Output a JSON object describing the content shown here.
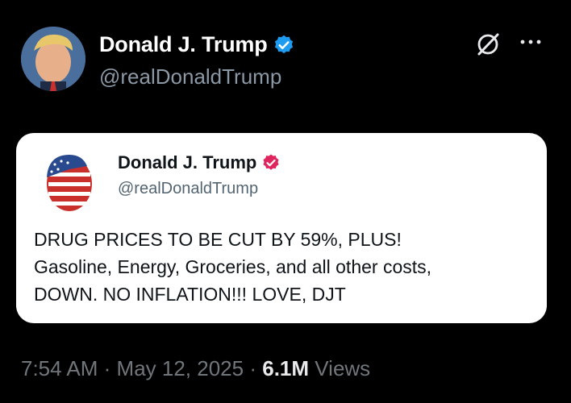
{
  "header": {
    "name": "Donald J. Trump",
    "handle": "@realDonaldTrump",
    "avatar_icon": "portrait-avatar",
    "verified_icon": "verified-badge-icon",
    "grok_icon": "grok-icon",
    "more_icon": "more-options-icon",
    "verified_color": "#1d9bf0"
  },
  "quoted_post": {
    "name": "Donald J. Trump",
    "handle": "@realDonaldTrump",
    "avatar_icon": "flag-portrait-avatar",
    "verified_icon": "verified-badge-icon",
    "verified_color": "#e0245e",
    "text_lines": [
      "DRUG PRICES TO BE CUT BY 59%, PLUS!",
      "Gasoline, Energy, Groceries, and all other costs,",
      "DOWN. NO INFLATION!!! LOVE, DJT"
    ]
  },
  "meta": {
    "time": "7:54 AM",
    "separator": "·",
    "date": "May 12, 2025",
    "views_count": "6.1M",
    "views_label": "Views"
  }
}
